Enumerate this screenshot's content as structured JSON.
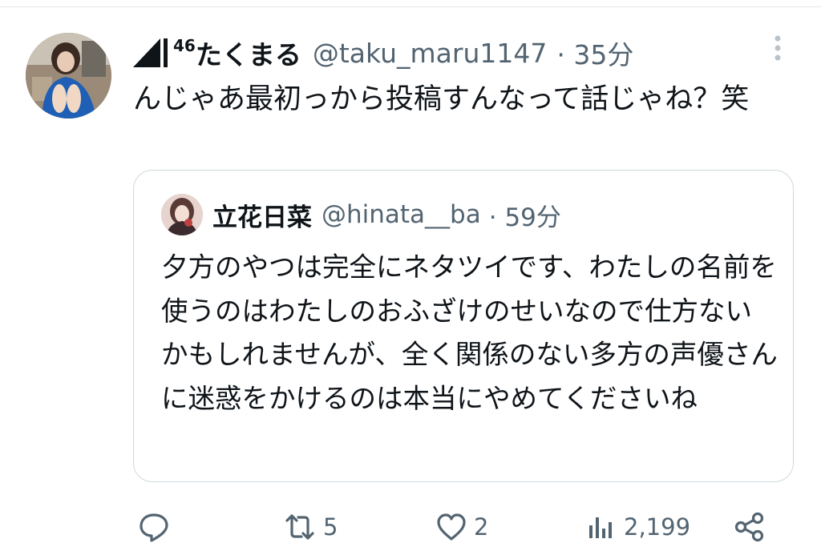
{
  "tweet": {
    "author_name": "たくまる",
    "author_badge": "46",
    "handle": "@taku_maru1147",
    "time": "· 35分",
    "text": "んじゃあ最初っから投稿すんなって話じゃね？笑"
  },
  "quoted_tweet": {
    "author_name": "立花日菜",
    "handle": "@hinata__ba",
    "time": "· 59分",
    "text": "夕方のやつは完全にネタツイです、わたしの名前を使うのはわたしのおふざけのせいなので仕方ないかもしれませんが、全く関係のない多方の声優さんに迷惑をかけるのは本当にやめてくださいね"
  },
  "actions": {
    "reply_count": "",
    "retweet_count": "5",
    "like_count": "2",
    "views_count": "2,199"
  },
  "colors": {
    "text_primary": "#0f1419",
    "text_secondary": "#536471",
    "border": "#cfd9de"
  },
  "icons": [
    "reply-icon",
    "retweet-icon",
    "like-icon",
    "views-icon",
    "share-icon",
    "more-options-icon"
  ]
}
